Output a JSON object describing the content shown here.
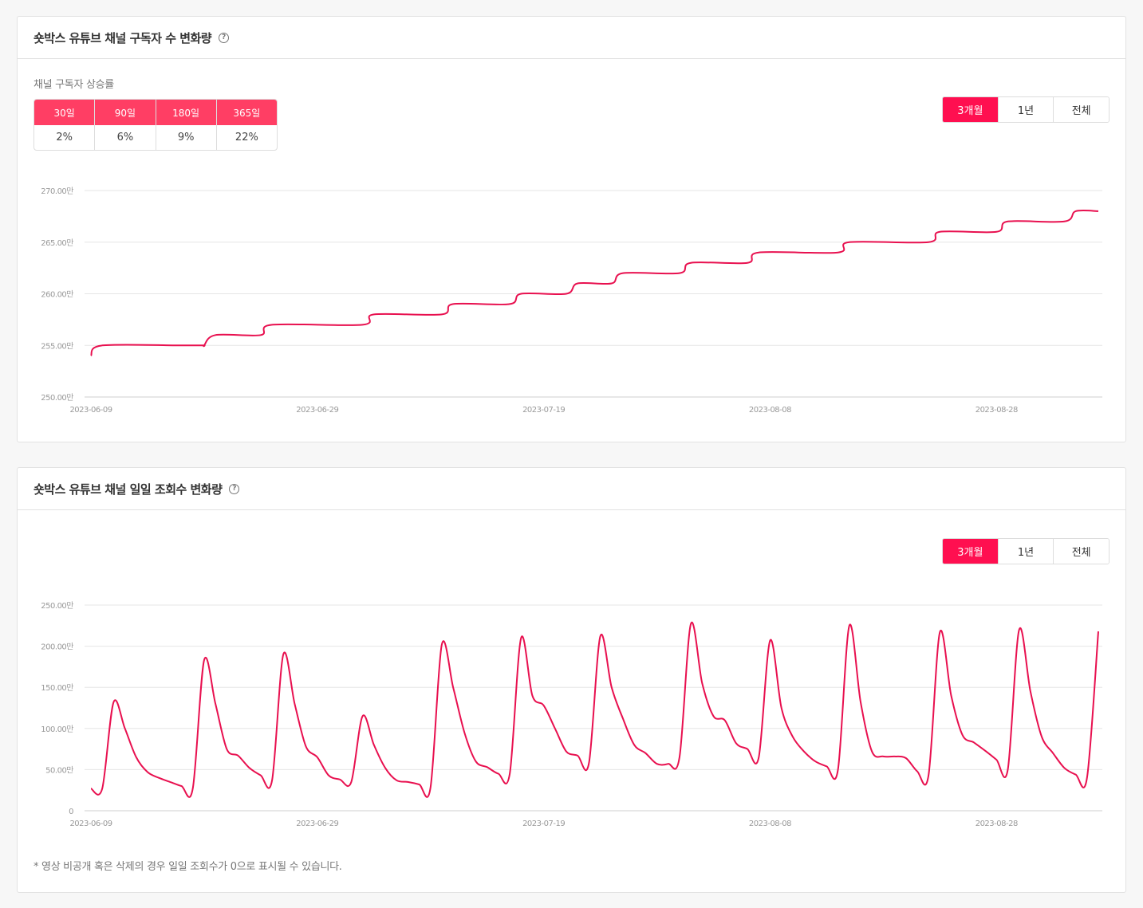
{
  "colors": {
    "accent": "#ff0f50",
    "table_header": "#ff3e64",
    "line": "#e8104f",
    "grid": "#e6e6e6",
    "axis_text": "#999999"
  },
  "subscriber_panel": {
    "title": "숏박스 유튜브 채널 구독자 수 변화량",
    "help_icon": "?",
    "growth_label": "채널 구독자 상승률",
    "growth": [
      {
        "period": "30일",
        "rate": "2%"
      },
      {
        "period": "90일",
        "rate": "6%"
      },
      {
        "period": "180일",
        "rate": "9%"
      },
      {
        "period": "365일",
        "rate": "22%"
      }
    ],
    "ranges": [
      "3개월",
      "1년",
      "전체"
    ],
    "active_range": "3개월"
  },
  "views_panel": {
    "title": "숏박스 유튜브 채널 일일 조회수 변화량",
    "help_icon": "?",
    "ranges": [
      "3개월",
      "1년",
      "전체"
    ],
    "active_range": "3개월",
    "note": "* 영상 비공개 혹은 삭제의 경우 일일 조회수가 0으로 표시될 수 있습니다."
  },
  "chart_data": [
    {
      "type": "line",
      "title": "숏박스 유튜브 채널 구독자 수 변화량",
      "x_start": "2023-06-09",
      "x_end": "2023-09-06",
      "ylim": [
        250,
        270
      ],
      "y_unit": "만",
      "y_ticks": [
        "250.00만",
        "255.00만",
        "260.00만",
        "265.00만",
        "270.00만"
      ],
      "x_ticks": [
        "2023-06-09",
        "2023-06-29",
        "2023-07-19",
        "2023-08-08",
        "2023-08-28"
      ],
      "grid": true,
      "series": [
        {
          "points": [
            [
              "2023-06-09",
              254
            ],
            [
              "2023-06-10",
              255
            ],
            [
              "2023-06-17",
              255
            ],
            [
              "2023-06-18",
              255
            ],
            [
              "2023-06-19",
              255
            ],
            [
              "2023-06-18",
              255
            ],
            [
              "2023-06-19",
              255
            ],
            [
              "2023-06-20",
              256
            ],
            [
              "2023-06-24",
              256
            ],
            [
              "2023-06-25",
              257
            ],
            [
              "2023-07-03",
              257
            ],
            [
              "2023-07-04",
              258
            ],
            [
              "2023-07-10",
              258
            ],
            [
              "2023-07-11",
              259
            ],
            [
              "2023-07-16",
              259
            ],
            [
              "2023-07-17",
              260
            ],
            [
              "2023-07-21",
              260
            ],
            [
              "2023-07-22",
              261
            ],
            [
              "2023-07-25",
              261
            ],
            [
              "2023-07-26",
              262
            ],
            [
              "2023-07-31",
              262
            ],
            [
              "2023-08-01",
              263
            ],
            [
              "2023-08-06",
              263
            ],
            [
              "2023-08-07",
              264
            ],
            [
              "2023-08-14",
              264
            ],
            [
              "2023-08-15",
              265
            ],
            [
              "2023-08-22",
              265
            ],
            [
              "2023-08-23",
              266
            ],
            [
              "2023-08-28",
              266
            ],
            [
              "2023-08-29",
              267
            ],
            [
              "2023-09-03",
              267
            ],
            [
              "2023-09-04",
              268
            ],
            [
              "2023-09-06",
              268
            ]
          ]
        }
      ]
    },
    {
      "type": "line",
      "title": "숏박스 유튜브 채널 일일 조회수 변화량",
      "x_start": "2023-06-09",
      "x_end": "2023-09-06",
      "ylim": [
        0,
        250
      ],
      "y_unit": "만",
      "y_ticks": [
        "0",
        "50.00만",
        "100.00만",
        "150.00만",
        "200.00만",
        "250.00만"
      ],
      "x_ticks": [
        "2023-06-09",
        "2023-06-29",
        "2023-07-19",
        "2023-08-08",
        "2023-08-28"
      ],
      "grid": true,
      "series": [
        {
          "points": [
            [
              "2023-06-09",
              27
            ],
            [
              "2023-06-10",
              27
            ],
            [
              "2023-06-11",
              132
            ],
            [
              "2023-06-12",
              100
            ],
            [
              "2023-06-13",
              65
            ],
            [
              "2023-06-14",
              47
            ],
            [
              "2023-06-15",
              40
            ],
            [
              "2023-06-16",
              35
            ],
            [
              "2023-06-17",
              30
            ],
            [
              "2023-06-18",
              27
            ],
            [
              "2023-06-19",
              183
            ],
            [
              "2023-06-20",
              130
            ],
            [
              "2023-06-21",
              75
            ],
            [
              "2023-06-22",
              67
            ],
            [
              "2023-06-23",
              52
            ],
            [
              "2023-06-24",
              43
            ],
            [
              "2023-06-25",
              37
            ],
            [
              "2023-06-26",
              190
            ],
            [
              "2023-06-27",
              130
            ],
            [
              "2023-06-28",
              78
            ],
            [
              "2023-06-29",
              65
            ],
            [
              "2023-06-30",
              43
            ],
            [
              "2023-07-01",
              38
            ],
            [
              "2023-07-02",
              35
            ],
            [
              "2023-07-03",
              115
            ],
            [
              "2023-07-04",
              80
            ],
            [
              "2023-07-05",
              52
            ],
            [
              "2023-07-06",
              37
            ],
            [
              "2023-07-07",
              35
            ],
            [
              "2023-07-08",
              32
            ],
            [
              "2023-07-09",
              28
            ],
            [
              "2023-07-10",
              202
            ],
            [
              "2023-07-11",
              150
            ],
            [
              "2023-07-12",
              95
            ],
            [
              "2023-07-13",
              60
            ],
            [
              "2023-07-14",
              53
            ],
            [
              "2023-07-15",
              45
            ],
            [
              "2023-07-16",
              45
            ],
            [
              "2023-07-17",
              210
            ],
            [
              "2023-07-18",
              140
            ],
            [
              "2023-07-19",
              128
            ],
            [
              "2023-07-20",
              100
            ],
            [
              "2023-07-21",
              72
            ],
            [
              "2023-07-22",
              67
            ],
            [
              "2023-07-23",
              58
            ],
            [
              "2023-07-24",
              212
            ],
            [
              "2023-07-25",
              150
            ],
            [
              "2023-07-26",
              112
            ],
            [
              "2023-07-27",
              80
            ],
            [
              "2023-07-28",
              70
            ],
            [
              "2023-07-29",
              57
            ],
            [
              "2023-07-30",
              57
            ],
            [
              "2023-07-31",
              65
            ],
            [
              "2023-08-01",
              227
            ],
            [
              "2023-08-02",
              155
            ],
            [
              "2023-08-03",
              115
            ],
            [
              "2023-08-04",
              110
            ],
            [
              "2023-08-05",
              82
            ],
            [
              "2023-08-06",
              75
            ],
            [
              "2023-08-07",
              65
            ],
            [
              "2023-08-08",
              207
            ],
            [
              "2023-08-09",
              125
            ],
            [
              "2023-08-10",
              90
            ],
            [
              "2023-08-11",
              72
            ],
            [
              "2023-08-12",
              60
            ],
            [
              "2023-08-13",
              54
            ],
            [
              "2023-08-14",
              50
            ],
            [
              "2023-08-15",
              225
            ],
            [
              "2023-08-16",
              132
            ],
            [
              "2023-08-17",
              72
            ],
            [
              "2023-08-18",
              66
            ],
            [
              "2023-08-19",
              66
            ],
            [
              "2023-08-20",
              64
            ],
            [
              "2023-08-21",
              48
            ],
            [
              "2023-08-22",
              43
            ],
            [
              "2023-08-23",
              217
            ],
            [
              "2023-08-24",
              140
            ],
            [
              "2023-08-25",
              92
            ],
            [
              "2023-08-26",
              83
            ],
            [
              "2023-08-27",
              73
            ],
            [
              "2023-08-28",
              62
            ],
            [
              "2023-08-29",
              50
            ],
            [
              "2023-08-30",
              220
            ],
            [
              "2023-08-31",
              145
            ],
            [
              "2023-09-01",
              90
            ],
            [
              "2023-09-02",
              70
            ],
            [
              "2023-09-03",
              52
            ],
            [
              "2023-09-04",
              44
            ],
            [
              "2023-09-05",
              40
            ],
            [
              "2023-09-06",
              218
            ]
          ]
        }
      ]
    }
  ]
}
